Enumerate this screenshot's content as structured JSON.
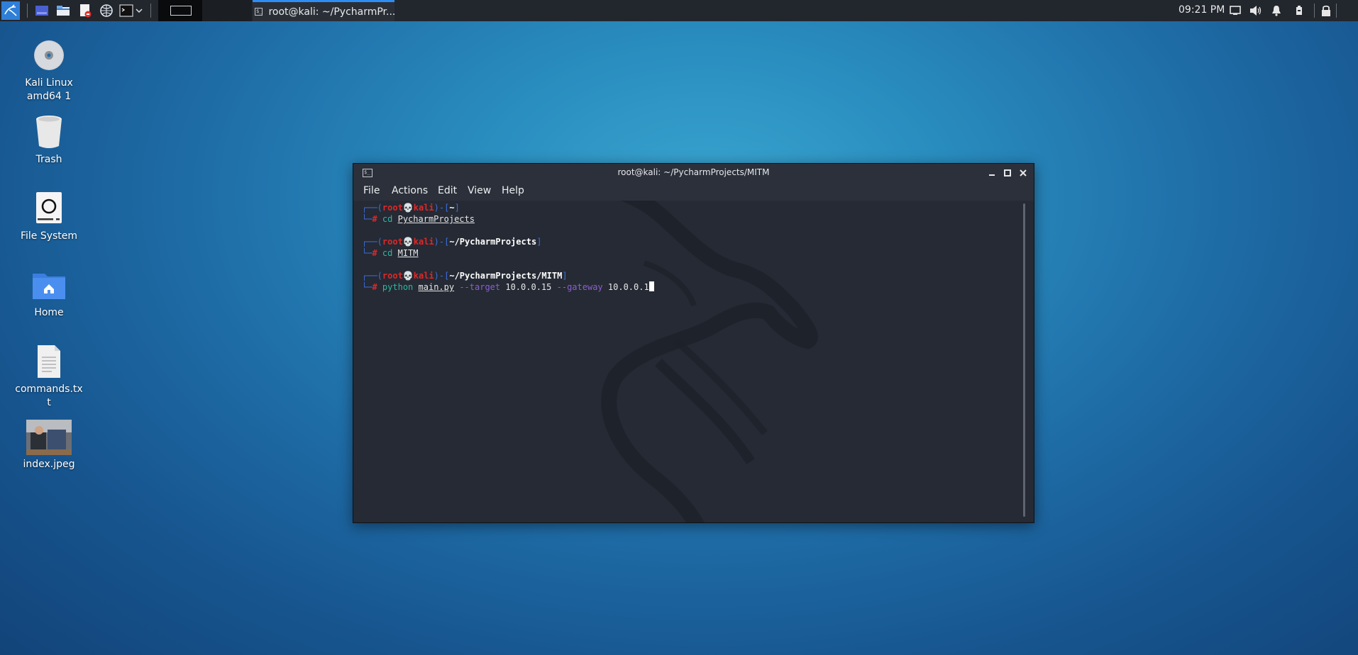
{
  "panel": {
    "launchers": [
      "kali-menu-icon",
      "workspace-switcher-icon",
      "file-manager-icon",
      "text-editor-icon",
      "web-browser-icon",
      "terminal-icon",
      "chevron-down-icon"
    ],
    "task": {
      "label": "root@kali: ~/PycharmPr..."
    },
    "clock": "09:21 PM",
    "tray": [
      "display-icon",
      "volume-icon",
      "notification-bell-icon",
      "battery-icon",
      "lock-icon"
    ]
  },
  "desktop": {
    "icons": [
      {
        "label": "Kali Linux\namd64 1",
        "icon": "disc-icon"
      },
      {
        "label": "Trash",
        "icon": "trash-icon"
      },
      {
        "label": "File System",
        "icon": "drive-icon"
      },
      {
        "label": "Home",
        "icon": "home-folder-icon"
      },
      {
        "label": "commands.tx\nt",
        "icon": "text-file-icon"
      },
      {
        "label": "index.jpeg",
        "icon": "image-thumbnail"
      }
    ]
  },
  "terminal": {
    "title": "root@kali: ~/PycharmProjects/MITM",
    "menu": [
      "File",
      "Actions",
      "Edit",
      "View",
      "Help"
    ],
    "prompts": [
      {
        "user": "root",
        "host": "kali",
        "path": "~",
        "command": "cd",
        "argument": "PycharmProjects"
      },
      {
        "user": "root",
        "host": "kali",
        "path": "~/PycharmProjects",
        "command": "cd",
        "argument": "MITM"
      },
      {
        "user": "root",
        "host": "kali",
        "path": "~/PycharmProjects/MITM",
        "command": "python",
        "argument": "main.py",
        "flag1": "--target",
        "value1": "10.0.0.15",
        "flag2": "--gateway",
        "value2": "10.0.0.1"
      }
    ]
  },
  "colors": {
    "accent": "#2f8cf5",
    "prompt_user": "#e02727",
    "prompt_frame": "#3d6fd8",
    "command": "#31b5a2",
    "flag": "#8c5fcf"
  }
}
